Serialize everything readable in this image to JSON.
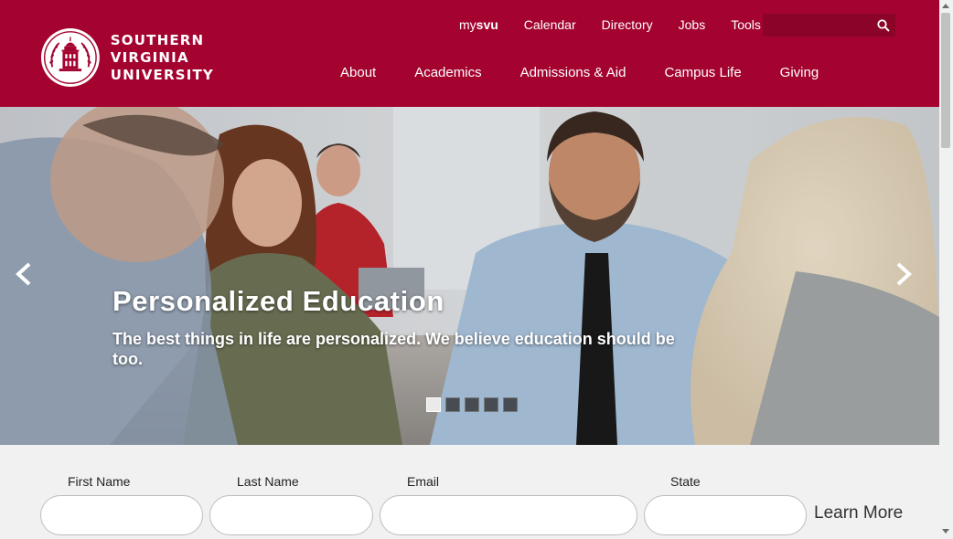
{
  "brand": {
    "line1": "SOUTHERN",
    "line2": "VIRGINIA",
    "line3": "UNIVERSITY",
    "color": "#a4032f"
  },
  "utility_nav": {
    "mysvu_prefix": "my",
    "mysvu_bold": "svu",
    "items": [
      "Calendar",
      "Directory",
      "Jobs",
      "Tools"
    ]
  },
  "search": {
    "placeholder": "",
    "icon": "search-icon"
  },
  "main_nav": {
    "items": [
      "About",
      "Academics",
      "Admissions & Aid",
      "Campus Life",
      "Giving"
    ]
  },
  "hero": {
    "title": "Personalized Education",
    "subtitle": "The best things in life are personalized. We believe education should be too.",
    "prev_icon": "chevron-left-icon",
    "next_icon": "chevron-right-icon",
    "slide_count": 5,
    "active_slide": 1
  },
  "form": {
    "first_name_label": "First Name",
    "last_name_label": "Last Name",
    "email_label": "Email",
    "state_label": "State",
    "first_name_value": "",
    "last_name_value": "",
    "email_value": "",
    "state_value": "",
    "submit_label": "Learn More"
  }
}
